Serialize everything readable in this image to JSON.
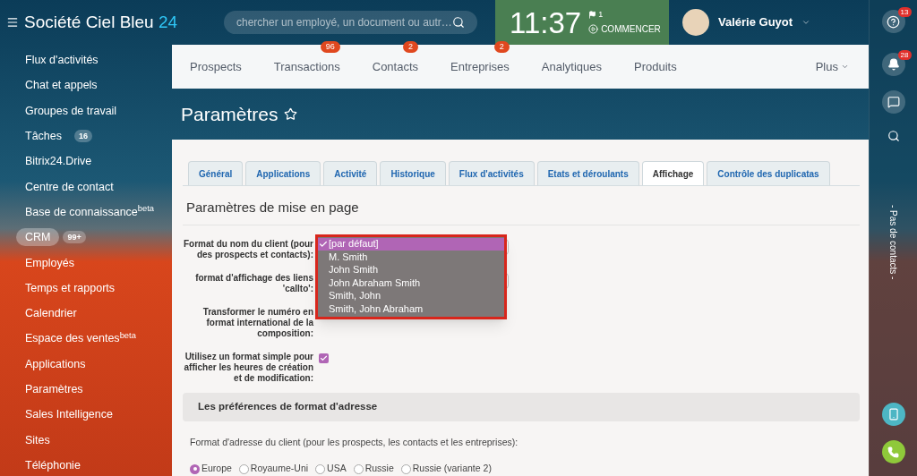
{
  "header": {
    "logo": {
      "name": "Société Ciel Bleu",
      "number": "24"
    },
    "search": {
      "placeholder": "chercher un employé, un document ou autr…"
    },
    "clock": {
      "time": "11:37",
      "flag_count": "1",
      "start_label": "COMMENCER"
    },
    "user": {
      "name": "Valérie Guyot"
    }
  },
  "sidebar": {
    "items": [
      {
        "label": "Flux d'activités",
        "selected": false
      },
      {
        "label": "Chat et appels",
        "selected": false
      },
      {
        "label": "Groupes de travail",
        "selected": false
      },
      {
        "label": "Tâches",
        "selected": false,
        "counter": "16"
      },
      {
        "label": "Bitrix24.Drive",
        "selected": false
      },
      {
        "label": "Centre de contact",
        "selected": false
      },
      {
        "label": "Base de connaissance$^{beta}$",
        "selected": false
      },
      {
        "label": "CRM",
        "selected": true,
        "counter": "99+"
      },
      {
        "label": "Employés",
        "selected": false
      },
      {
        "label": "Temps et rapports",
        "selected": false
      },
      {
        "label": "Calendrier",
        "selected": false
      },
      {
        "label": "Espace des ventes$^{beta}$",
        "selected": false
      },
      {
        "label": "Applications",
        "selected": false
      },
      {
        "label": "Paramètres",
        "selected": false
      },
      {
        "label": "Sales Intelligence",
        "selected": false
      },
      {
        "label": "Sites",
        "selected": false
      },
      {
        "label": "Téléphonie",
        "selected": false
      }
    ]
  },
  "crm_nav": {
    "items": [
      {
        "label": "Prospects"
      },
      {
        "label": "Transactions",
        "counter": "96"
      },
      {
        "label": "Contacts",
        "counter": "2"
      },
      {
        "label": "Entreprises",
        "counter": "2"
      },
      {
        "label": "Analytiques"
      },
      {
        "label": "Produits"
      }
    ],
    "more": "Plus"
  },
  "page_title": "Paramètres",
  "tabs": [
    {
      "label": "Général",
      "selected": false
    },
    {
      "label": "Applications",
      "selected": false
    },
    {
      "label": "Activité",
      "selected": false
    },
    {
      "label": "Historique",
      "selected": false
    },
    {
      "label": "Flux d'activités",
      "selected": false
    },
    {
      "label": "Etats et déroulants",
      "selected": false
    },
    {
      "label": "Affichage",
      "selected": true
    },
    {
      "label": "Contrôle des duplicatas",
      "selected": false
    }
  ],
  "section_title": "Paramètres de mise en page",
  "fields": [
    {
      "kind": "select",
      "label": "Format du nom du client (pour des prospects et contacts):",
      "options": [
        {
          "label": "[par défaut]",
          "selected": true
        },
        {
          "label": "M. Smith",
          "selected": false
        },
        {
          "label": "John Smith",
          "selected": false
        },
        {
          "label": "John Abraham Smith",
          "selected": false
        },
        {
          "label": "Smith, John",
          "selected": false
        },
        {
          "label": "Smith, John Abraham",
          "selected": false
        }
      ]
    },
    {
      "kind": "select",
      "label": "format d'affichage des liens 'callto':"
    },
    {
      "kind": "hidden",
      "label": "Transformer le numéro en format international de la composition:"
    },
    {
      "kind": "checkbox",
      "label": "Utilisez un format simple pour afficher les heures de création et de modification:",
      "checked": true
    }
  ],
  "address": {
    "title": "Les préférences de format d'adresse",
    "label": "Format d'adresse du client (pour les prospects, les contacts et les entreprises):",
    "options": [
      {
        "label": "Europe",
        "selected": true
      },
      {
        "label": "Royaume-Uni",
        "selected": false
      },
      {
        "label": "USA",
        "selected": false
      },
      {
        "label": "Russie",
        "selected": false
      },
      {
        "label": "Russie (variante 2)",
        "selected": false
      }
    ]
  },
  "right_bar": {
    "help_count": "13",
    "notifications_count": "28",
    "contacts_note": "- Pas de contacts -"
  }
}
